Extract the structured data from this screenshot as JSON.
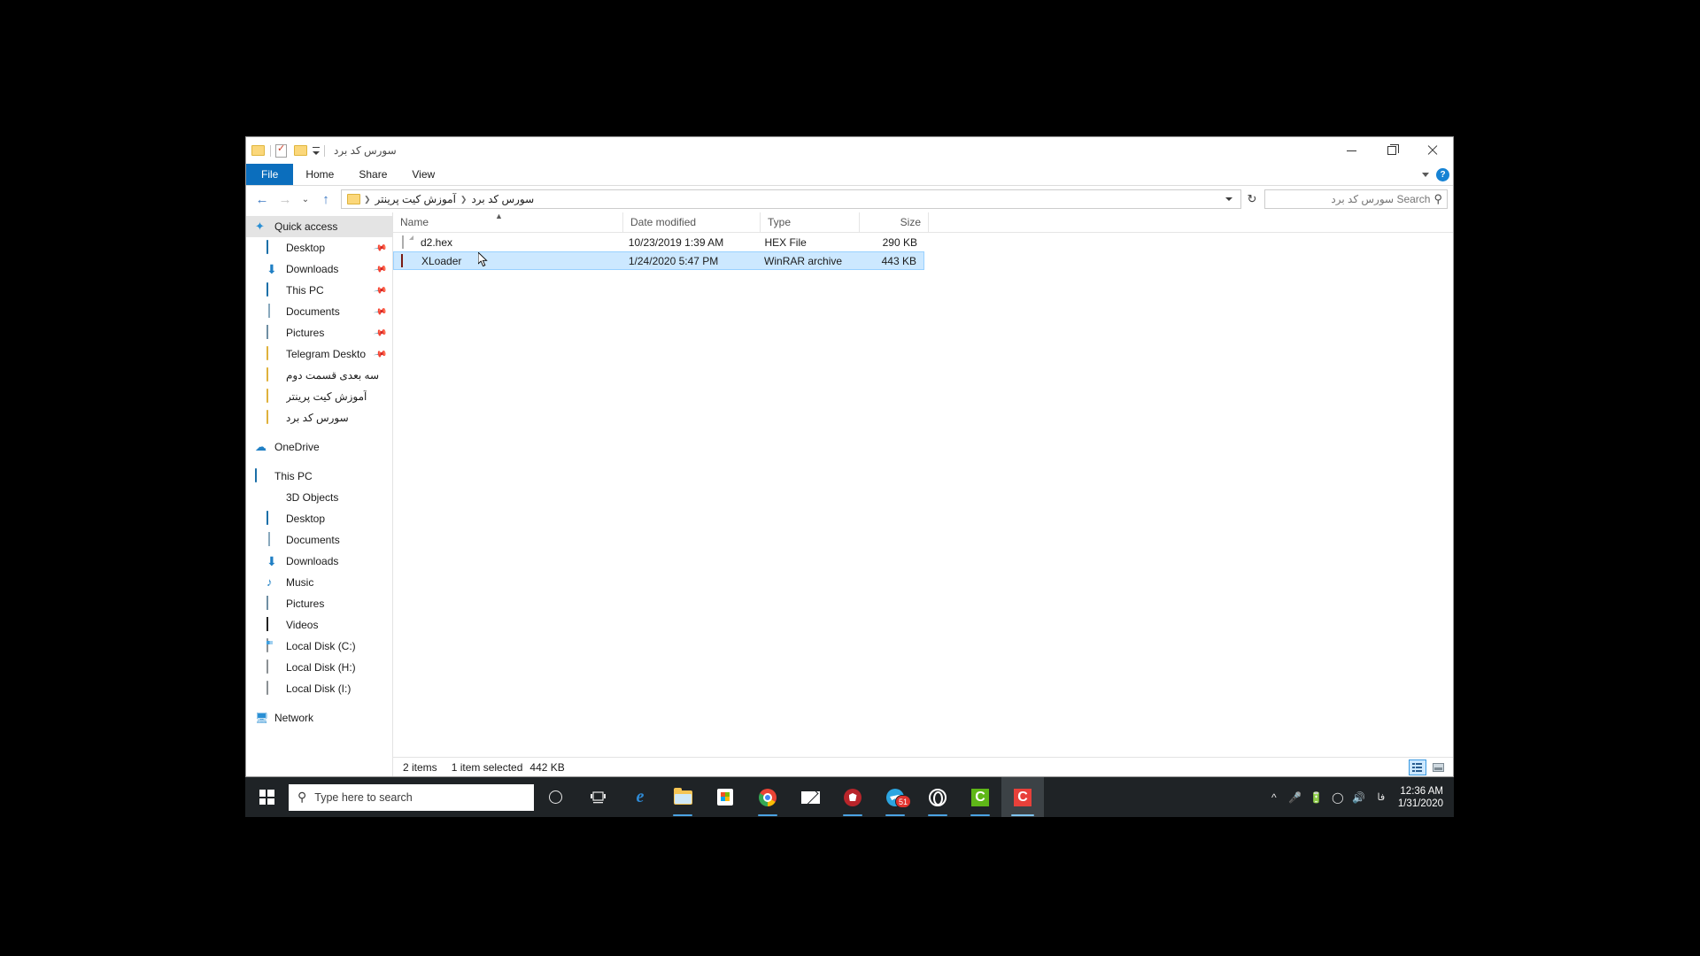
{
  "window": {
    "title": "سورس کد برد",
    "quick_access_toolbar": [
      "folder-icon",
      "properties-icon",
      "new-folder-icon",
      "customize-caret-icon"
    ],
    "controls": {
      "minimize": "minimize-icon",
      "restore": "restore-icon",
      "close": "close-icon"
    }
  },
  "ribbon": {
    "tabs": [
      {
        "label": "File",
        "active": true
      },
      {
        "label": "Home",
        "active": false
      },
      {
        "label": "Share",
        "active": false
      },
      {
        "label": "View",
        "active": false
      }
    ],
    "collapse_icon": "chevron-down-icon",
    "help_icon": "help-icon",
    "help_label": "?"
  },
  "address": {
    "back": "←",
    "forward": "→",
    "recent": "⌄",
    "up": "↑",
    "breadcrumbs": [
      {
        "label": "آموزش کیت پرینتر"
      },
      {
        "label": "سورس کد برد"
      }
    ],
    "separator": "❯",
    "dropdown_icon": "chevron-down-icon",
    "refresh_icon": "↻"
  },
  "search": {
    "placeholder": "Search سورس کد برد",
    "value": "",
    "icon": "search-icon"
  },
  "sidebar": {
    "groups": [
      {
        "header": {
          "label": "Quick access",
          "icon": "quick-access-star-icon",
          "selected": true
        },
        "items": [
          {
            "label": "Desktop",
            "icon": "desktop-icon",
            "pinned": true,
            "rtl": false
          },
          {
            "label": "Downloads",
            "icon": "downloads-icon",
            "pinned": true,
            "rtl": false
          },
          {
            "label": "This PC",
            "icon": "this-pc-icon",
            "pinned": true,
            "rtl": false
          },
          {
            "label": "Documents",
            "icon": "documents-icon",
            "pinned": true,
            "rtl": false
          },
          {
            "label": "Pictures",
            "icon": "pictures-icon",
            "pinned": true,
            "rtl": false
          },
          {
            "label": "Telegram Deskto",
            "icon": "folder-icon",
            "pinned": true,
            "rtl": false
          },
          {
            "label": "سه بعدی قسمت دوم",
            "icon": "folder-icon",
            "pinned": false,
            "rtl": true
          },
          {
            "label": "آموزش کیت پرینتر",
            "icon": "folder-icon",
            "pinned": false,
            "rtl": true
          },
          {
            "label": "سورس کد برد",
            "icon": "folder-icon",
            "pinned": false,
            "rtl": true
          }
        ]
      },
      {
        "header": {
          "label": "OneDrive",
          "icon": "onedrive-cloud-icon",
          "selected": false
        },
        "items": []
      },
      {
        "header": {
          "label": "This PC",
          "icon": "this-pc-icon",
          "selected": false
        },
        "items": [
          {
            "label": "3D Objects",
            "icon": "3d-objects-icon",
            "pinned": false,
            "rtl": false
          },
          {
            "label": "Desktop",
            "icon": "desktop-icon",
            "pinned": false,
            "rtl": false
          },
          {
            "label": "Documents",
            "icon": "documents-icon",
            "pinned": false,
            "rtl": false
          },
          {
            "label": "Downloads",
            "icon": "downloads-icon",
            "pinned": false,
            "rtl": false
          },
          {
            "label": "Music",
            "icon": "music-icon",
            "pinned": false,
            "rtl": false
          },
          {
            "label": "Pictures",
            "icon": "pictures-icon",
            "pinned": false,
            "rtl": false
          },
          {
            "label": "Videos",
            "icon": "videos-icon",
            "pinned": false,
            "rtl": false
          },
          {
            "label": "Local Disk (C:)",
            "icon": "system-drive-icon",
            "pinned": false,
            "rtl": false
          },
          {
            "label": "Local Disk (H:)",
            "icon": "drive-icon",
            "pinned": false,
            "rtl": false
          },
          {
            "label": "Local Disk (I:)",
            "icon": "drive-icon",
            "pinned": false,
            "rtl": false
          }
        ]
      },
      {
        "header": {
          "label": "Network",
          "icon": "network-icon",
          "selected": false
        },
        "items": []
      }
    ]
  },
  "filelist": {
    "columns": [
      {
        "key": "name",
        "label": "Name",
        "sorted": true,
        "sort_icon": "sort-ascending-icon"
      },
      {
        "key": "date",
        "label": "Date modified",
        "sorted": false
      },
      {
        "key": "type",
        "label": "Type",
        "sorted": false
      },
      {
        "key": "size",
        "label": "Size",
        "sorted": false
      }
    ],
    "rows": [
      {
        "name": "d2.hex",
        "date": "10/23/2019 1:39 AM",
        "type": "HEX File",
        "size": "290 KB",
        "icon": "hex-file-icon",
        "selected": false
      },
      {
        "name": "XLoader",
        "date": "1/24/2020 5:47 PM",
        "type": "WinRAR archive",
        "size": "443 KB",
        "icon": "winrar-archive-icon",
        "selected": true
      }
    ]
  },
  "statusbar": {
    "item_count": "2 items",
    "selection": "1 item selected",
    "selection_size": "442 KB",
    "views": [
      {
        "name": "details-view",
        "label": "Details view",
        "active": true
      },
      {
        "name": "large-icons-view",
        "label": "Large icons view",
        "active": false
      }
    ]
  },
  "taskbar": {
    "start_label": "Start",
    "search_placeholder": "Type here to search",
    "search_icon": "search-icon",
    "buttons": [
      {
        "name": "cortana-button",
        "icon": "cortana-circle-icon",
        "running": false,
        "active": false
      },
      {
        "name": "task-view-button",
        "icon": "task-view-icon",
        "running": false,
        "active": false
      },
      {
        "name": "edge-button",
        "icon": "edge-icon",
        "running": false,
        "active": false
      },
      {
        "name": "file-explorer-button",
        "icon": "file-explorer-icon",
        "running": true,
        "active": false
      },
      {
        "name": "microsoft-store-button",
        "icon": "microsoft-store-icon",
        "running": false,
        "active": false
      },
      {
        "name": "chrome-button",
        "icon": "chrome-icon",
        "running": true,
        "active": false
      },
      {
        "name": "mail-button",
        "icon": "mail-icon",
        "running": false,
        "active": false
      },
      {
        "name": "security-button",
        "icon": "shield-icon",
        "running": true,
        "active": false
      },
      {
        "name": "telegram-button",
        "icon": "telegram-icon",
        "running": true,
        "active": false,
        "badge": "51"
      },
      {
        "name": "opera-button",
        "icon": "opera-icon",
        "running": true,
        "active": false
      },
      {
        "name": "green-app-button",
        "icon": "green-c-icon",
        "label": "C",
        "running": true,
        "active": false
      },
      {
        "name": "red-app-button",
        "icon": "red-c-icon",
        "label": "C",
        "running": true,
        "active": true
      }
    ],
    "tray": {
      "overflow_icon": "chevron-up-icon",
      "microphone_icon": "microphone-icon",
      "battery_icon": "battery-icon",
      "wifi_icon": "wifi-icon",
      "volume_icon": "volume-icon",
      "language": "فا",
      "time": "12:36 AM",
      "date": "1/31/2020"
    }
  },
  "colors": {
    "accent": "#0b6ebd",
    "selection": "#cce8ff",
    "taskbar": "#1f2326"
  }
}
